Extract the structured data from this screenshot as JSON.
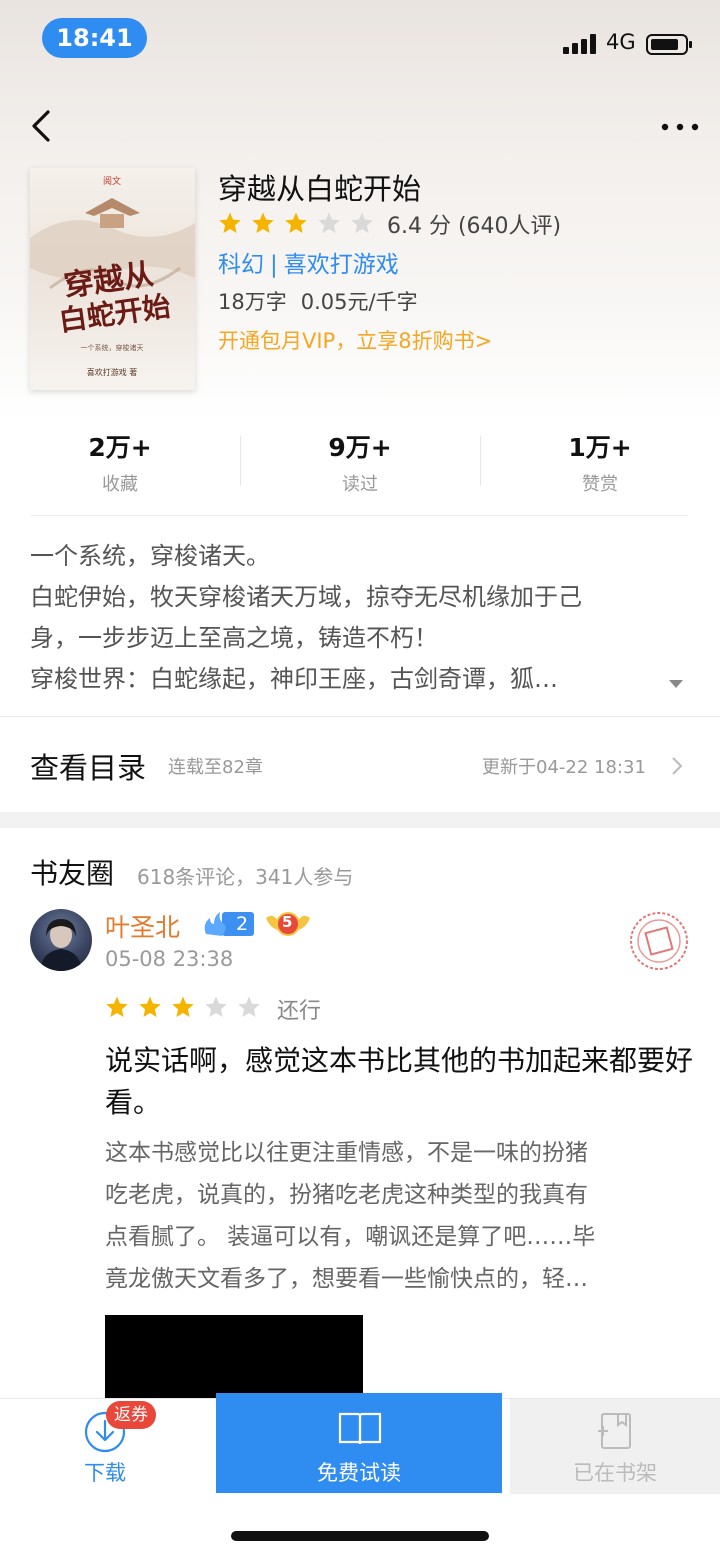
{
  "status_bar": {
    "time": "18:41",
    "network": "4G",
    "battery_level": 0.8
  },
  "book": {
    "title": "穿越从白蛇开始",
    "cover": {
      "publisher_logo": "阅文",
      "title_line1": "穿越从",
      "title_line2": "白蛇开始",
      "tagline": "一个系统，穿梭诸天",
      "author_line": "喜欢打游戏 著"
    },
    "rating": {
      "stars": 3,
      "max_stars": 5,
      "text": "6.4 分 (640人评)"
    },
    "tags": [
      "科幻",
      "喜欢打游戏"
    ],
    "tag_separator": "|",
    "word_count": "18万字",
    "price": "0.05元/千字",
    "vip_promo": "开通包月VIP，立享8折购书>"
  },
  "stats": [
    {
      "value": "2万+",
      "label": "收藏"
    },
    {
      "value": "9万+",
      "label": "读过"
    },
    {
      "value": "1万+",
      "label": "赞赏"
    }
  ],
  "intro": {
    "lines": [
      "一个系统，穿梭诸天。",
      "白蛇伊始，牧天穿梭诸天万域，掠夺无尽机缘加于己",
      "身，一步步迈上至高之境，铸造不朽！",
      "穿梭世界：白蛇缘起，神印王座，古剑奇谭，狐…"
    ]
  },
  "catalog": {
    "title": "查看目录",
    "status": "连载至82章",
    "updated": "更新于04-22 18:31"
  },
  "comments_section": {
    "title": "书友圈",
    "count": "618条评论，341人参与",
    "comment": {
      "user_name": "叶圣北",
      "level": "2",
      "vip_level": "5",
      "time": "05-08 23:38",
      "stars": 3,
      "rating_word": "还行",
      "headline": "说实话啊，感觉这本书比其他的书加起来都要好看。",
      "body_lines": [
        "这本书感觉比以往更注重情感，不是一味的扮猪",
        "吃老虎，说真的，扮猪吃老虎这种类型的我真有",
        "点看腻了。  装逼可以有，嘲讽还是算了吧……毕",
        "竟龙傲天文看多了，想要看一些愉快点的，轻…"
      ]
    }
  },
  "bottom_bar": {
    "download_label": "下载",
    "coupon_badge": "返券",
    "read_label": "免费试读",
    "shelf_label": "已在书架"
  },
  "colors": {
    "accent_blue": "#2f8cf0",
    "star_gold": "#f5b400",
    "promo_orange": "#f5a623",
    "username_orange": "#e37b2e",
    "badge_red": "#e8473a"
  }
}
